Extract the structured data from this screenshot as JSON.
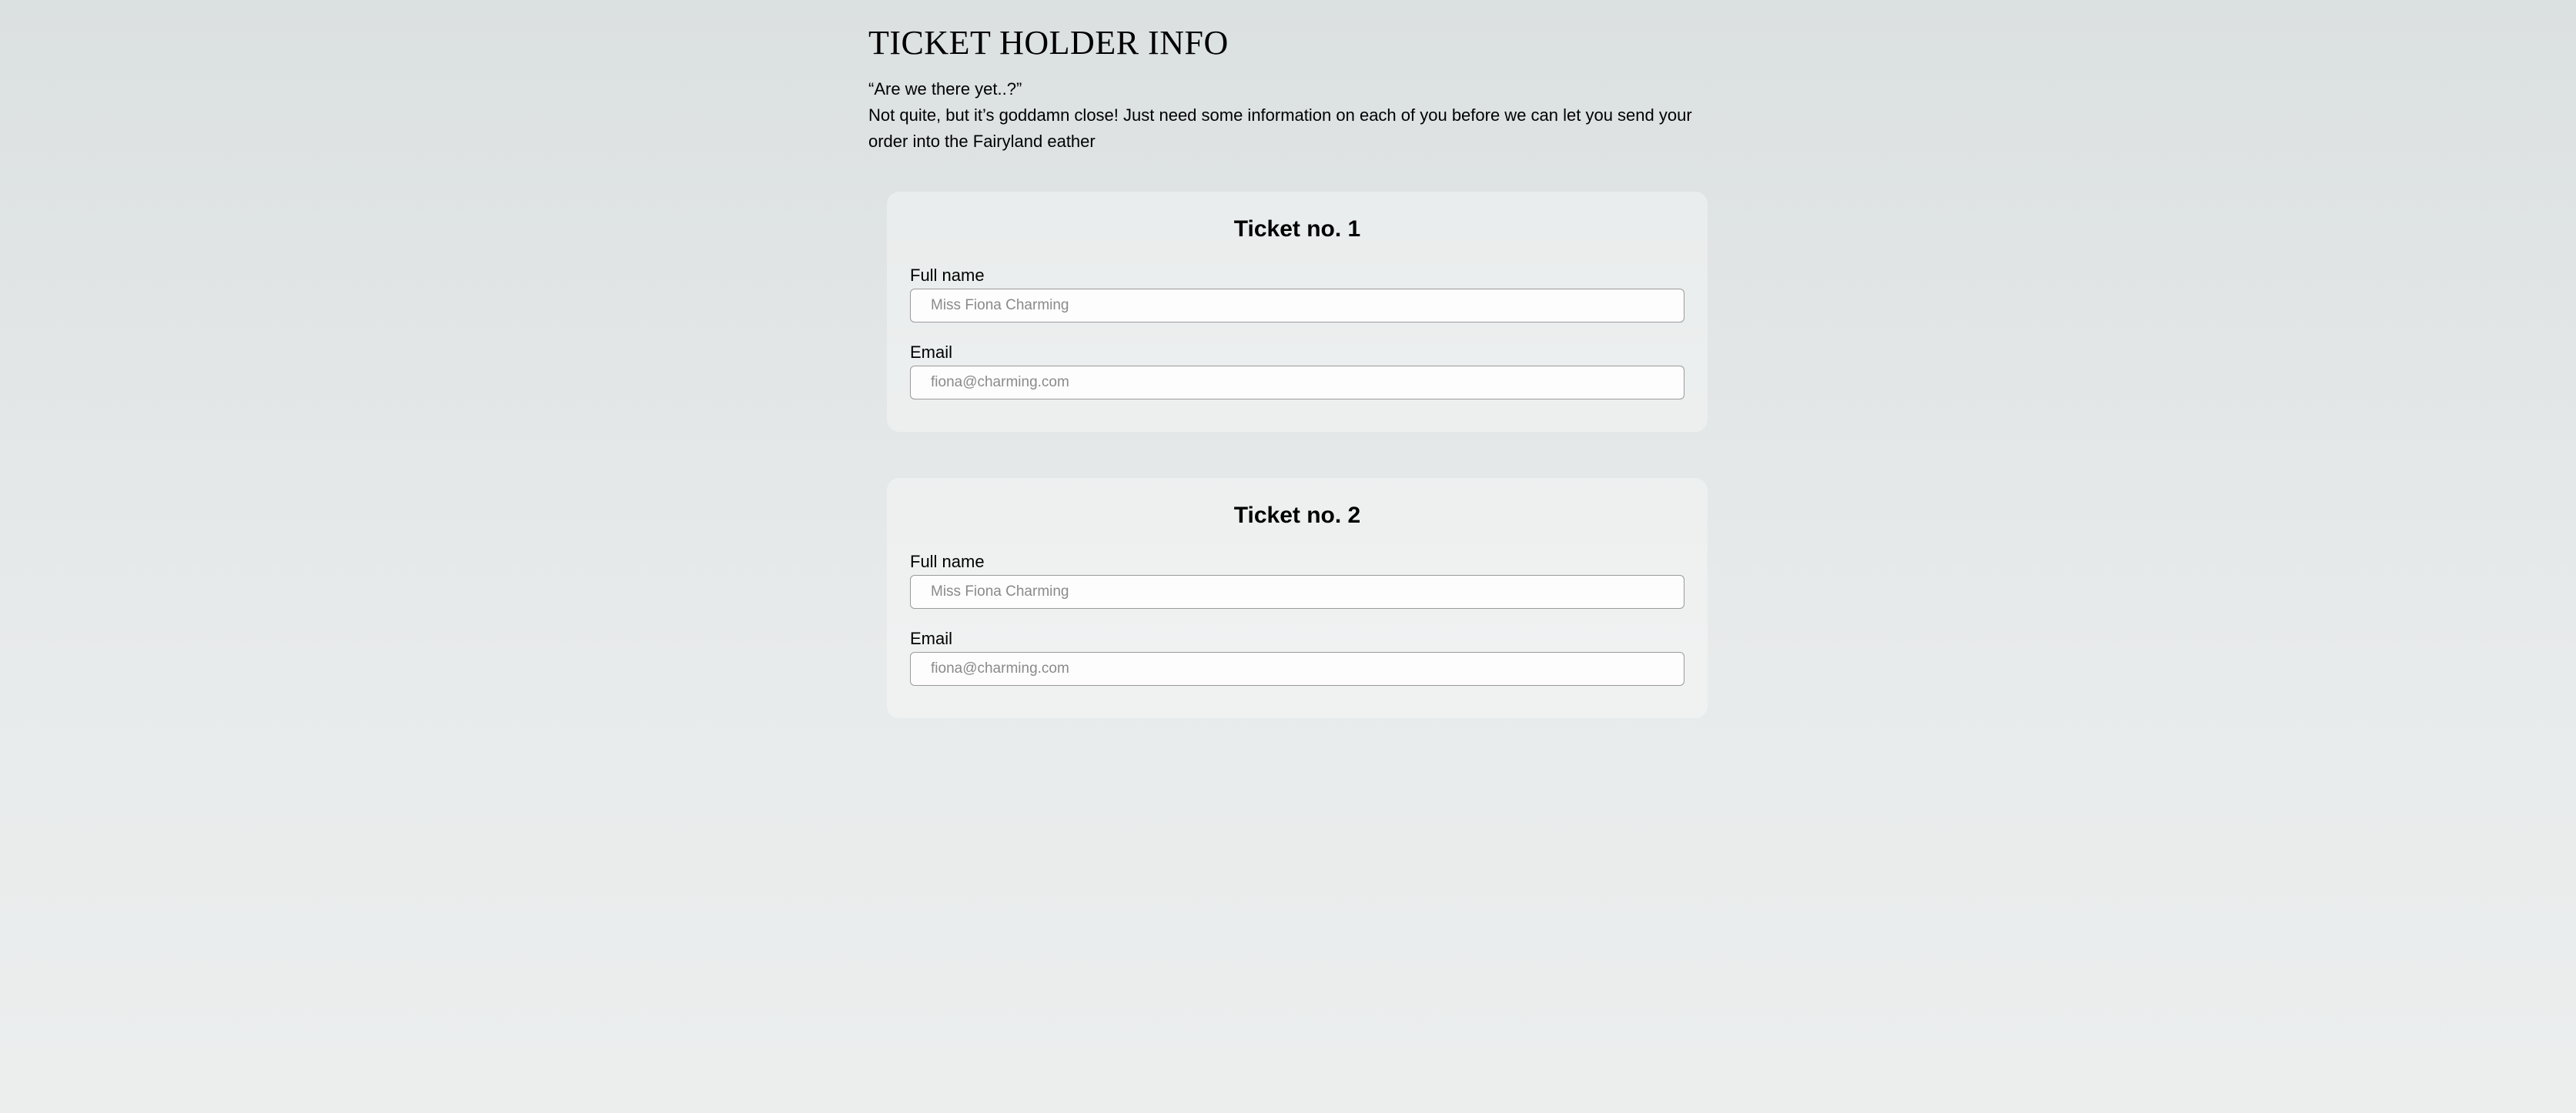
{
  "header": {
    "title": "TICKET HOLDER INFO",
    "intro_line1": "“Are we there yet..?”",
    "intro_line2": "Not quite, but it’s goddamn close! Just need some information on each of you before we can let you send your order into the Fairyland eather"
  },
  "tickets": [
    {
      "title": "Ticket no. 1",
      "fullname_label": "Full name",
      "fullname_placeholder": "Miss Fiona Charming",
      "fullname_value": "",
      "email_label": "Email",
      "email_placeholder": "fiona@charming.com",
      "email_value": ""
    },
    {
      "title": "Ticket no. 2",
      "fullname_label": "Full name",
      "fullname_placeholder": "Miss Fiona Charming",
      "fullname_value": "",
      "email_label": "Email",
      "email_placeholder": "fiona@charming.com",
      "email_value": ""
    }
  ]
}
